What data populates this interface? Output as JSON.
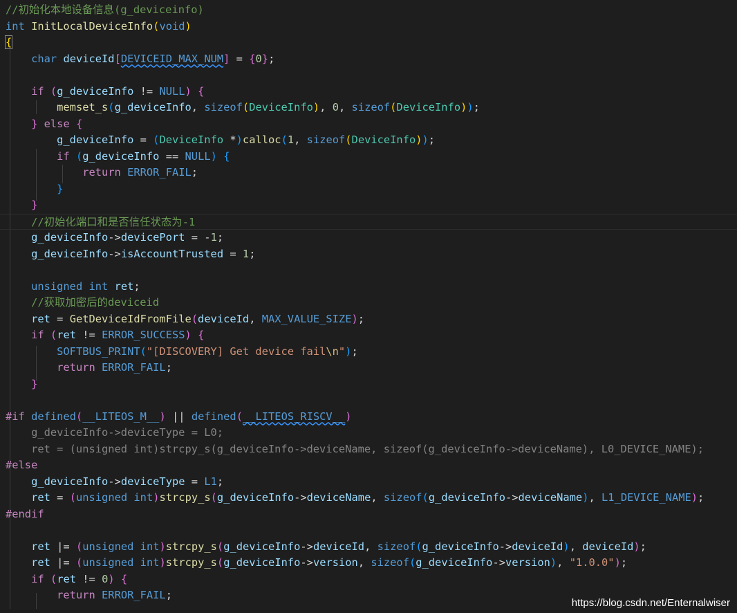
{
  "editor": {
    "language": "c",
    "theme_colors": {
      "background": "#1e1e1e",
      "keyword": "#569cd6",
      "control": "#c586c0",
      "function": "#dcdcaa",
      "type": "#4ec9b0",
      "variable": "#9cdcfe",
      "number": "#b5cea8",
      "string": "#ce9178",
      "comment": "#6a9955"
    },
    "lines": [
      [
        {
          "t": "//初始化本地设备信息(g_deviceinfo)",
          "c": "cm"
        }
      ],
      [
        {
          "t": "int",
          "c": "ck"
        },
        {
          "t": " "
        },
        {
          "t": "InitLocalDeviceInfo",
          "c": "cf"
        },
        {
          "t": "(",
          "c": "cb1"
        },
        {
          "t": "void",
          "c": "ck"
        },
        {
          "t": ")",
          "c": "cb1"
        }
      ],
      [
        {
          "t": "{",
          "c": "cb1"
        }
      ],
      [
        {
          "t": "    "
        },
        {
          "t": "char",
          "c": "ck"
        },
        {
          "t": " "
        },
        {
          "t": "deviceId",
          "c": "cv"
        },
        {
          "t": "[",
          "c": "cb2"
        },
        {
          "t": "DEVICEID_MAX_NUM",
          "c": "ck"
        },
        {
          "t": "]",
          "c": "cb2"
        },
        {
          "t": " = "
        },
        {
          "t": "{",
          "c": "cb2"
        },
        {
          "t": "0",
          "c": "cn"
        },
        {
          "t": "}",
          "c": "cb2"
        },
        {
          "t": ";"
        }
      ],
      [],
      [
        {
          "t": "    "
        },
        {
          "t": "if",
          "c": "cc"
        },
        {
          "t": " "
        },
        {
          "t": "(",
          "c": "cb2"
        },
        {
          "t": "g_deviceInfo",
          "c": "cv"
        },
        {
          "t": " != "
        },
        {
          "t": "NULL",
          "c": "ck"
        },
        {
          "t": ")",
          "c": "cb2"
        },
        {
          "t": " "
        },
        {
          "t": "{",
          "c": "cb2"
        }
      ],
      [
        {
          "t": "        "
        },
        {
          "t": "memset_s",
          "c": "cf"
        },
        {
          "t": "(",
          "c": "cb3"
        },
        {
          "t": "g_deviceInfo",
          "c": "cv"
        },
        {
          "t": ", "
        },
        {
          "t": "sizeof",
          "c": "ck"
        },
        {
          "t": "(",
          "c": "cb1"
        },
        {
          "t": "DeviceInfo",
          "c": "ct"
        },
        {
          "t": ")",
          "c": "cb1"
        },
        {
          "t": ", "
        },
        {
          "t": "0",
          "c": "cn"
        },
        {
          "t": ", "
        },
        {
          "t": "sizeof",
          "c": "ck"
        },
        {
          "t": "(",
          "c": "cb1"
        },
        {
          "t": "DeviceInfo",
          "c": "ct"
        },
        {
          "t": ")",
          "c": "cb1"
        },
        {
          "t": ")",
          "c": "cb3"
        },
        {
          "t": ";"
        }
      ],
      [
        {
          "t": "    "
        },
        {
          "t": "}",
          "c": "cb2"
        },
        {
          "t": " "
        },
        {
          "t": "else",
          "c": "cc"
        },
        {
          "t": " "
        },
        {
          "t": "{",
          "c": "cb2"
        }
      ],
      [
        {
          "t": "        "
        },
        {
          "t": "g_deviceInfo",
          "c": "cv"
        },
        {
          "t": " = "
        },
        {
          "t": "(",
          "c": "cb3"
        },
        {
          "t": "DeviceInfo",
          "c": "ct"
        },
        {
          "t": " *"
        },
        {
          "t": ")",
          "c": "cb3"
        },
        {
          "t": "calloc",
          "c": "cf"
        },
        {
          "t": "(",
          "c": "cb3"
        },
        {
          "t": "1",
          "c": "cn"
        },
        {
          "t": ", "
        },
        {
          "t": "sizeof",
          "c": "ck"
        },
        {
          "t": "(",
          "c": "cb1"
        },
        {
          "t": "DeviceInfo",
          "c": "ct"
        },
        {
          "t": ")",
          "c": "cb1"
        },
        {
          "t": ")",
          "c": "cb3"
        },
        {
          "t": ";"
        }
      ],
      [
        {
          "t": "        "
        },
        {
          "t": "if",
          "c": "cc"
        },
        {
          "t": " "
        },
        {
          "t": "(",
          "c": "cb3"
        },
        {
          "t": "g_deviceInfo",
          "c": "cv"
        },
        {
          "t": " == "
        },
        {
          "t": "NULL",
          "c": "ck"
        },
        {
          "t": ")",
          "c": "cb3"
        },
        {
          "t": " "
        },
        {
          "t": "{",
          "c": "cb3"
        }
      ],
      [
        {
          "t": "            "
        },
        {
          "t": "return",
          "c": "cc"
        },
        {
          "t": " "
        },
        {
          "t": "ERROR_FAIL",
          "c": "ck"
        },
        {
          "t": ";"
        }
      ],
      [
        {
          "t": "        "
        },
        {
          "t": "}",
          "c": "cb3"
        }
      ],
      [
        {
          "t": "    "
        },
        {
          "t": "}",
          "c": "cb2"
        }
      ],
      [
        {
          "t": "    "
        },
        {
          "t": "//初始化端口和是否信任状态为-1",
          "c": "cm"
        }
      ],
      [
        {
          "t": "    "
        },
        {
          "t": "g_deviceInfo",
          "c": "cv"
        },
        {
          "t": "->"
        },
        {
          "t": "devicePort",
          "c": "cv"
        },
        {
          "t": " = -"
        },
        {
          "t": "1",
          "c": "cn"
        },
        {
          "t": ";"
        }
      ],
      [
        {
          "t": "    "
        },
        {
          "t": "g_deviceInfo",
          "c": "cv"
        },
        {
          "t": "->"
        },
        {
          "t": "isAccountTrusted",
          "c": "cv"
        },
        {
          "t": " = "
        },
        {
          "t": "1",
          "c": "cn"
        },
        {
          "t": ";"
        }
      ],
      [],
      [
        {
          "t": "    "
        },
        {
          "t": "unsigned",
          "c": "ck"
        },
        {
          "t": " "
        },
        {
          "t": "int",
          "c": "ck"
        },
        {
          "t": " "
        },
        {
          "t": "ret",
          "c": "cv"
        },
        {
          "t": ";"
        }
      ],
      [
        {
          "t": "    "
        },
        {
          "t": "//获取加密后的deviceid",
          "c": "cm"
        }
      ],
      [
        {
          "t": "    "
        },
        {
          "t": "ret",
          "c": "cv"
        },
        {
          "t": " = "
        },
        {
          "t": "GetDeviceIdFromFile",
          "c": "cf"
        },
        {
          "t": "(",
          "c": "cb2"
        },
        {
          "t": "deviceId",
          "c": "cv"
        },
        {
          "t": ", "
        },
        {
          "t": "MAX_VALUE_SIZE",
          "c": "ck"
        },
        {
          "t": ")",
          "c": "cb2"
        },
        {
          "t": ";"
        }
      ],
      [
        {
          "t": "    "
        },
        {
          "t": "if",
          "c": "cc"
        },
        {
          "t": " "
        },
        {
          "t": "(",
          "c": "cb2"
        },
        {
          "t": "ret",
          "c": "cv"
        },
        {
          "t": " != "
        },
        {
          "t": "ERROR_SUCCESS",
          "c": "ck"
        },
        {
          "t": ")",
          "c": "cb2"
        },
        {
          "t": " "
        },
        {
          "t": "{",
          "c": "cb2"
        }
      ],
      [
        {
          "t": "        "
        },
        {
          "t": "SOFTBUS_PRINT",
          "c": "ck"
        },
        {
          "t": "(",
          "c": "cb3"
        },
        {
          "t": "\"[DISCOVERY] Get device fail",
          "c": "cs"
        },
        {
          "t": "\\n",
          "c": "ce"
        },
        {
          "t": "\"",
          "c": "cs"
        },
        {
          "t": ")",
          "c": "cb3"
        },
        {
          "t": ";"
        }
      ],
      [
        {
          "t": "        "
        },
        {
          "t": "return",
          "c": "cc"
        },
        {
          "t": " "
        },
        {
          "t": "ERROR_FAIL",
          "c": "ck"
        },
        {
          "t": ";"
        }
      ],
      [
        {
          "t": "    "
        },
        {
          "t": "}",
          "c": "cb2"
        }
      ],
      [],
      [
        {
          "t": "#if",
          "c": "cpp"
        },
        {
          "t": " "
        },
        {
          "t": "defined",
          "c": "ck"
        },
        {
          "t": "(",
          "c": "cb2"
        },
        {
          "t": "__LITEOS_M__",
          "c": "ck"
        },
        {
          "t": ")",
          "c": "cb2"
        },
        {
          "t": " || "
        },
        {
          "t": "defined",
          "c": "ck"
        },
        {
          "t": "(",
          "c": "cb2"
        },
        {
          "t": "__LITEOS_RISCV__",
          "c": "ck"
        },
        {
          "t": ")",
          "c": "cb2"
        }
      ],
      [
        {
          "t": "    g_deviceInfo->deviceType = L0;",
          "c": "cp",
          "d": true
        }
      ],
      [
        {
          "t": "    ret = (unsigned int)strcpy_s(g_deviceInfo->deviceName, sizeof(g_deviceInfo->deviceName), L0_DEVICE_NAME);",
          "c": "cp",
          "d": true
        }
      ],
      [
        {
          "t": "#else",
          "c": "cpp"
        }
      ],
      [
        {
          "t": "    "
        },
        {
          "t": "g_deviceInfo",
          "c": "cv"
        },
        {
          "t": "->"
        },
        {
          "t": "deviceType",
          "c": "cv"
        },
        {
          "t": " = "
        },
        {
          "t": "L1",
          "c": "ck"
        },
        {
          "t": ";"
        }
      ],
      [
        {
          "t": "    "
        },
        {
          "t": "ret",
          "c": "cv"
        },
        {
          "t": " = "
        },
        {
          "t": "(",
          "c": "cb2"
        },
        {
          "t": "unsigned",
          "c": "ck"
        },
        {
          "t": " "
        },
        {
          "t": "int",
          "c": "ck"
        },
        {
          "t": ")",
          "c": "cb2"
        },
        {
          "t": "strcpy_s",
          "c": "cf"
        },
        {
          "t": "(",
          "c": "cb2"
        },
        {
          "t": "g_deviceInfo",
          "c": "cv"
        },
        {
          "t": "->"
        },
        {
          "t": "deviceName",
          "c": "cv"
        },
        {
          "t": ", "
        },
        {
          "t": "sizeof",
          "c": "ck"
        },
        {
          "t": "(",
          "c": "cb3"
        },
        {
          "t": "g_deviceInfo",
          "c": "cv"
        },
        {
          "t": "->"
        },
        {
          "t": "deviceName",
          "c": "cv"
        },
        {
          "t": ")",
          "c": "cb3"
        },
        {
          "t": ", "
        },
        {
          "t": "L1_DEVICE_NAME",
          "c": "ck"
        },
        {
          "t": ")",
          "c": "cb2"
        },
        {
          "t": ";"
        }
      ],
      [
        {
          "t": "#endif",
          "c": "cpp"
        }
      ],
      [],
      [
        {
          "t": "    "
        },
        {
          "t": "ret",
          "c": "cv"
        },
        {
          "t": " |= "
        },
        {
          "t": "(",
          "c": "cb2"
        },
        {
          "t": "unsigned",
          "c": "ck"
        },
        {
          "t": " "
        },
        {
          "t": "int",
          "c": "ck"
        },
        {
          "t": ")",
          "c": "cb2"
        },
        {
          "t": "strcpy_s",
          "c": "cf"
        },
        {
          "t": "(",
          "c": "cb2"
        },
        {
          "t": "g_deviceInfo",
          "c": "cv"
        },
        {
          "t": "->"
        },
        {
          "t": "deviceId",
          "c": "cv"
        },
        {
          "t": ", "
        },
        {
          "t": "sizeof",
          "c": "ck"
        },
        {
          "t": "(",
          "c": "cb3"
        },
        {
          "t": "g_deviceInfo",
          "c": "cv"
        },
        {
          "t": "->"
        },
        {
          "t": "deviceId",
          "c": "cv"
        },
        {
          "t": ")",
          "c": "cb3"
        },
        {
          "t": ", "
        },
        {
          "t": "deviceId",
          "c": "cv"
        },
        {
          "t": ")",
          "c": "cb2"
        },
        {
          "t": ";"
        }
      ],
      [
        {
          "t": "    "
        },
        {
          "t": "ret",
          "c": "cv"
        },
        {
          "t": " |= "
        },
        {
          "t": "(",
          "c": "cb2"
        },
        {
          "t": "unsigned",
          "c": "ck"
        },
        {
          "t": " "
        },
        {
          "t": "int",
          "c": "ck"
        },
        {
          "t": ")",
          "c": "cb2"
        },
        {
          "t": "strcpy_s",
          "c": "cf"
        },
        {
          "t": "(",
          "c": "cb2"
        },
        {
          "t": "g_deviceInfo",
          "c": "cv"
        },
        {
          "t": "->"
        },
        {
          "t": "version",
          "c": "cv"
        },
        {
          "t": ", "
        },
        {
          "t": "sizeof",
          "c": "ck"
        },
        {
          "t": "(",
          "c": "cb3"
        },
        {
          "t": "g_deviceInfo",
          "c": "cv"
        },
        {
          "t": "->"
        },
        {
          "t": "version",
          "c": "cv"
        },
        {
          "t": ")",
          "c": "cb3"
        },
        {
          "t": ", "
        },
        {
          "t": "\"1.0.0\"",
          "c": "cs"
        },
        {
          "t": ")",
          "c": "cb2"
        },
        {
          "t": ";"
        }
      ],
      [
        {
          "t": "    "
        },
        {
          "t": "if",
          "c": "cc"
        },
        {
          "t": " "
        },
        {
          "t": "(",
          "c": "cb2"
        },
        {
          "t": "ret",
          "c": "cv"
        },
        {
          "t": " != "
        },
        {
          "t": "0",
          "c": "cn"
        },
        {
          "t": ")",
          "c": "cb2"
        },
        {
          "t": " "
        },
        {
          "t": "{",
          "c": "cb2"
        }
      ],
      [
        {
          "t": "        "
        },
        {
          "t": "return",
          "c": "cc"
        },
        {
          "t": " "
        },
        {
          "t": "ERROR_FAIL",
          "c": "ck"
        },
        {
          "t": ";"
        }
      ]
    ]
  },
  "watermark": "https://blog.csdn.net/Enternalwiser"
}
